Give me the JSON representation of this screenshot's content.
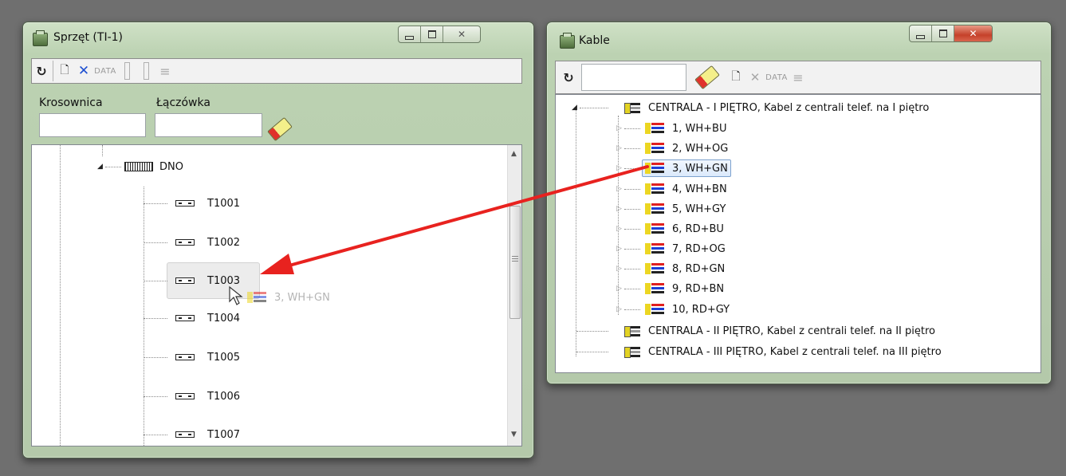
{
  "window_left": {
    "title": "Sprzęt (TI-1)",
    "toolbar": {
      "refresh": "↻",
      "new": "🗋",
      "delete": "✕",
      "data": "DATA",
      "list": "≡"
    },
    "fields": {
      "krosownica_label": "Krosownica",
      "krosownica_value": "",
      "laczowka_label": "Łączówka",
      "laczowka_value": ""
    },
    "tree": {
      "parent": "DNO",
      "items": [
        "T1001",
        "T1002",
        "T1003",
        "T1004",
        "T1005",
        "T1006",
        "T1007"
      ],
      "drag_ghost": "3, WH+GN"
    }
  },
  "window_right": {
    "title": "Kable",
    "toolbar": {
      "refresh": "↻",
      "new": "🗋",
      "delete": "✕",
      "data": "DATA",
      "list": "≡",
      "search_value": ""
    },
    "tree": {
      "root": "CENTRALA - I PIĘTRO, Kabel z centrali telef. na I piętro",
      "pairs": [
        "1, WH+BU",
        "2, WH+OG",
        "3, WH+GN",
        "4, WH+BN",
        "5, WH+GY",
        "6, RD+BU",
        "7, RD+OG",
        "8, RD+GN",
        "9, RD+BN",
        "10, RD+GY"
      ],
      "others": [
        "CENTRALA - II PIĘTRO, Kabel z centrali telef. na II piętro",
        "CENTRALA - III PIĘTRO, Kabel z centrali telef. na III piętro"
      ]
    }
  },
  "colors": {
    "arrow": "#e8221f",
    "frame": "#bcd2b2",
    "selection": "#dbe9fb"
  }
}
